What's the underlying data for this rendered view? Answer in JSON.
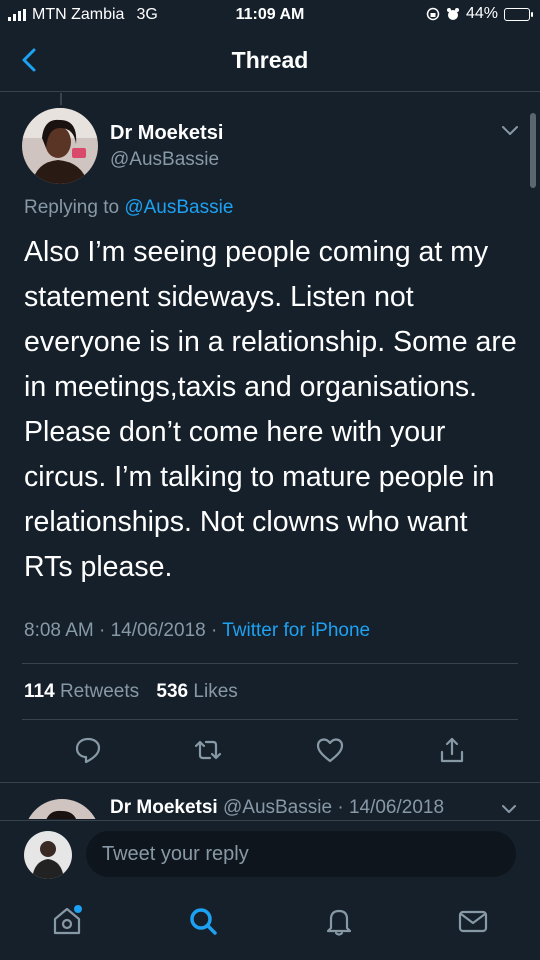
{
  "status_bar": {
    "carrier": "MTN Zambia",
    "network": "3G",
    "time": "11:09 AM",
    "battery_percent": "44%",
    "battery_level": 0.44
  },
  "header": {
    "title": "Thread",
    "back_icon": "chevron-left-icon"
  },
  "tweet": {
    "author_name": "Dr Moeketsi",
    "author_handle": "@AusBassie",
    "replying_prefix": "Replying to",
    "replying_to": "@AusBassie",
    "text": "Also I’m seeing people coming at my statement sideways. Listen not everyone is in a relationship. Some are in meetings,taxis and organisations. Please don’t come here with your circus. I’m talking to mature people in relationships. Not clowns who want RTs please.",
    "time": "8:08 AM",
    "date": "14/06/2018",
    "source": "Twitter for iPhone",
    "retweets_count": "114",
    "retweets_label": "Retweets",
    "likes_count": "536",
    "likes_label": "Likes"
  },
  "next_tweet": {
    "author_name": "Dr Moeketsi",
    "author_handle": "@AusBassie",
    "date": "14/06/2018"
  },
  "reply": {
    "placeholder": "Tweet your reply"
  },
  "colors": {
    "background": "#15202b",
    "accent": "#1da1f2",
    "secondary_text": "#8899a6",
    "divider": "#38444d"
  }
}
